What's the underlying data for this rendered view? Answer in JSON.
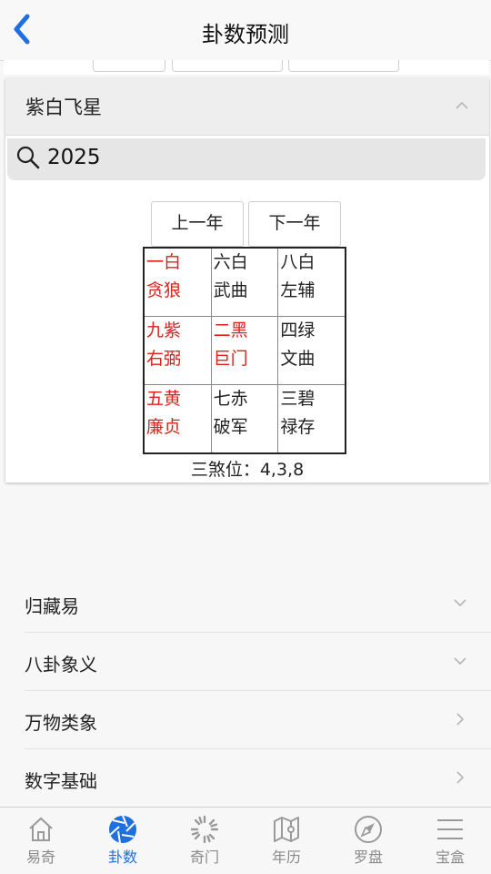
{
  "header": {
    "title": "卦数预测"
  },
  "panel": {
    "title": "紫白飞星",
    "search_value": "2025",
    "prev_label": "上一年",
    "next_label": "下一年",
    "grid": [
      [
        {
          "star": "一白",
          "name": "贪狼",
          "color": "red"
        },
        {
          "star": "六白",
          "name": "武曲",
          "color": "black"
        },
        {
          "star": "八白",
          "name": "左辅",
          "color": "black"
        }
      ],
      [
        {
          "star": "九紫",
          "name": "右弼",
          "color": "red"
        },
        {
          "star": "二黑",
          "name": "巨门",
          "color": "red"
        },
        {
          "star": "四绿",
          "name": "文曲",
          "color": "black"
        }
      ],
      [
        {
          "star": "五黄",
          "name": "廉贞",
          "color": "red"
        },
        {
          "star": "七赤",
          "name": "破军",
          "color": "black"
        },
        {
          "star": "三碧",
          "name": "禄存",
          "color": "black"
        }
      ]
    ],
    "sha": "三煞位：4,3,8"
  },
  "list": [
    {
      "label": "归藏易",
      "icon": "chevron-down-icon"
    },
    {
      "label": "八卦象义",
      "icon": "chevron-down-icon"
    },
    {
      "label": "万物类象",
      "icon": "chevron-right-icon"
    },
    {
      "label": "数字基础",
      "icon": "chevron-right-icon"
    }
  ],
  "tabs": [
    {
      "label": "易奇",
      "icon": "house-icon",
      "active": false
    },
    {
      "label": "卦数",
      "icon": "aperture-icon",
      "active": true
    },
    {
      "label": "奇门",
      "icon": "spinner-icon",
      "active": false
    },
    {
      "label": "年历",
      "icon": "map-icon",
      "active": false
    },
    {
      "label": "罗盘",
      "icon": "compass-icon",
      "active": false
    },
    {
      "label": "宝盒",
      "icon": "menu-icon",
      "active": false
    }
  ],
  "colors": {
    "accent": "#1e6fe0",
    "red": "#e1201a",
    "tab_inactive": "#8a8a8a"
  }
}
